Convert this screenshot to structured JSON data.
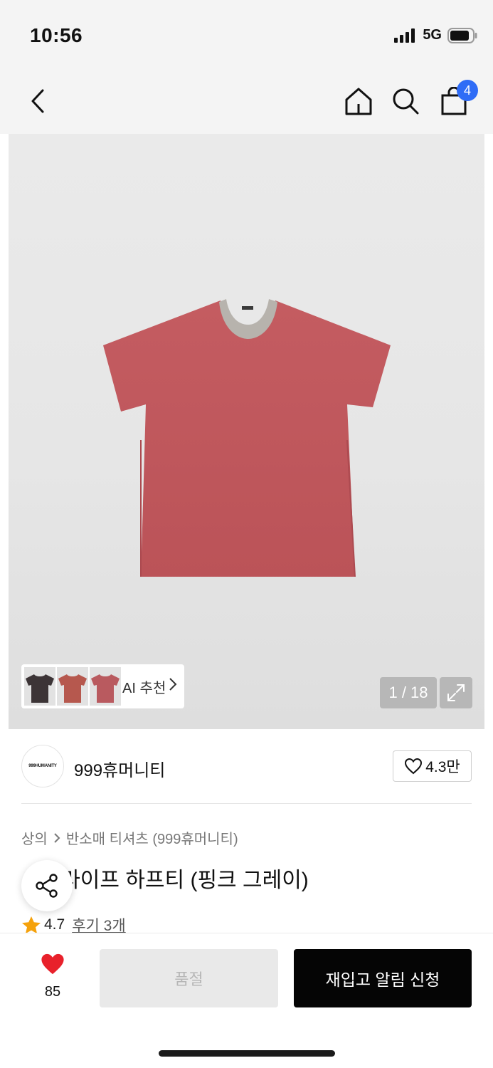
{
  "status_bar": {
    "time": "10:56",
    "network": "5G"
  },
  "nav": {
    "icons": [
      "back-icon",
      "home-icon",
      "search-icon",
      "bag-icon"
    ],
    "cart_count": "4"
  },
  "gallery": {
    "ai_recommend_label": "AI 추천",
    "counter": "1 / 18"
  },
  "brand": {
    "logo_text": "999HUMANITY",
    "name": "999휴머니티",
    "likes": "4.3만"
  },
  "product": {
    "breadcrumb": [
      "상의",
      "반소매 티셔츠 (999휴머니티)"
    ],
    "title": "스트라이프 하프티 (핑크 그레이)",
    "rating": "4.7",
    "reviews": "후기 3개"
  },
  "bottom": {
    "wish_count": "85",
    "soldout_label": "품절",
    "restock_label": "재입고 알림 신청"
  },
  "colors": {
    "accent_badge": "#2f6cf6",
    "wish_heart": "#e8212b",
    "star": "#f5a20c"
  }
}
